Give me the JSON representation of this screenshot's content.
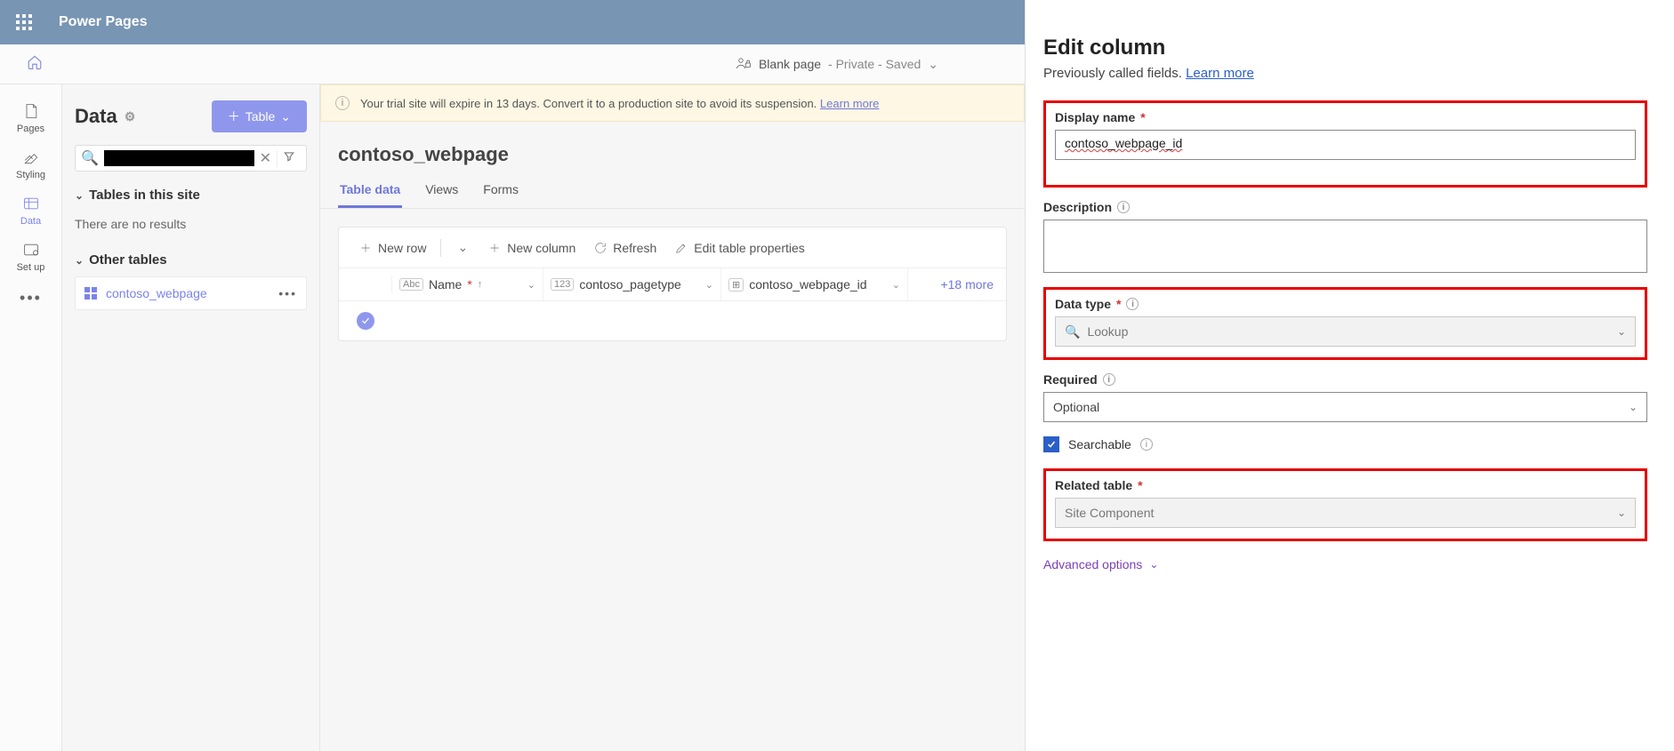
{
  "header": {
    "app_title": "Power Pages"
  },
  "page_bar": {
    "page_name": "Blank page",
    "status": " - Private - Saved"
  },
  "rail": {
    "pages": "Pages",
    "styling": "Styling",
    "data": "Data",
    "setup": "Set up"
  },
  "tables_panel": {
    "title": "Data",
    "table_btn": "Table",
    "section_site": "Tables in this site",
    "empty": "There are no results",
    "section_other": "Other tables",
    "item_label": "contoso_webpage"
  },
  "banner": {
    "text": "Your trial site will expire in 13 days. Convert it to a production site to avoid its suspension.",
    "link": "Learn more"
  },
  "content": {
    "title": "contoso_webpage",
    "tabs": {
      "data": "Table data",
      "views": "Views",
      "forms": "Forms"
    },
    "toolbar": {
      "new_row": "New row",
      "new_col": "New column",
      "refresh": "Refresh",
      "edit_props": "Edit table properties"
    },
    "columns": {
      "name": "Name",
      "pagetype": "contoso_pagetype",
      "webpage_id": "contoso_webpage_id",
      "more": "+18 more"
    }
  },
  "panel": {
    "title": "Edit column",
    "subtitle_prefix": "Previously called fields. ",
    "learn_more": "Learn more",
    "display_name_label": "Display name",
    "display_name_value": "contoso_webpage_id",
    "description_label": "Description",
    "data_type_label": "Data type",
    "data_type_value": "Lookup",
    "required_label": "Required",
    "required_value": "Optional",
    "searchable_label": "Searchable",
    "related_label": "Related table",
    "related_value": "Site Component",
    "advanced": "Advanced options"
  }
}
